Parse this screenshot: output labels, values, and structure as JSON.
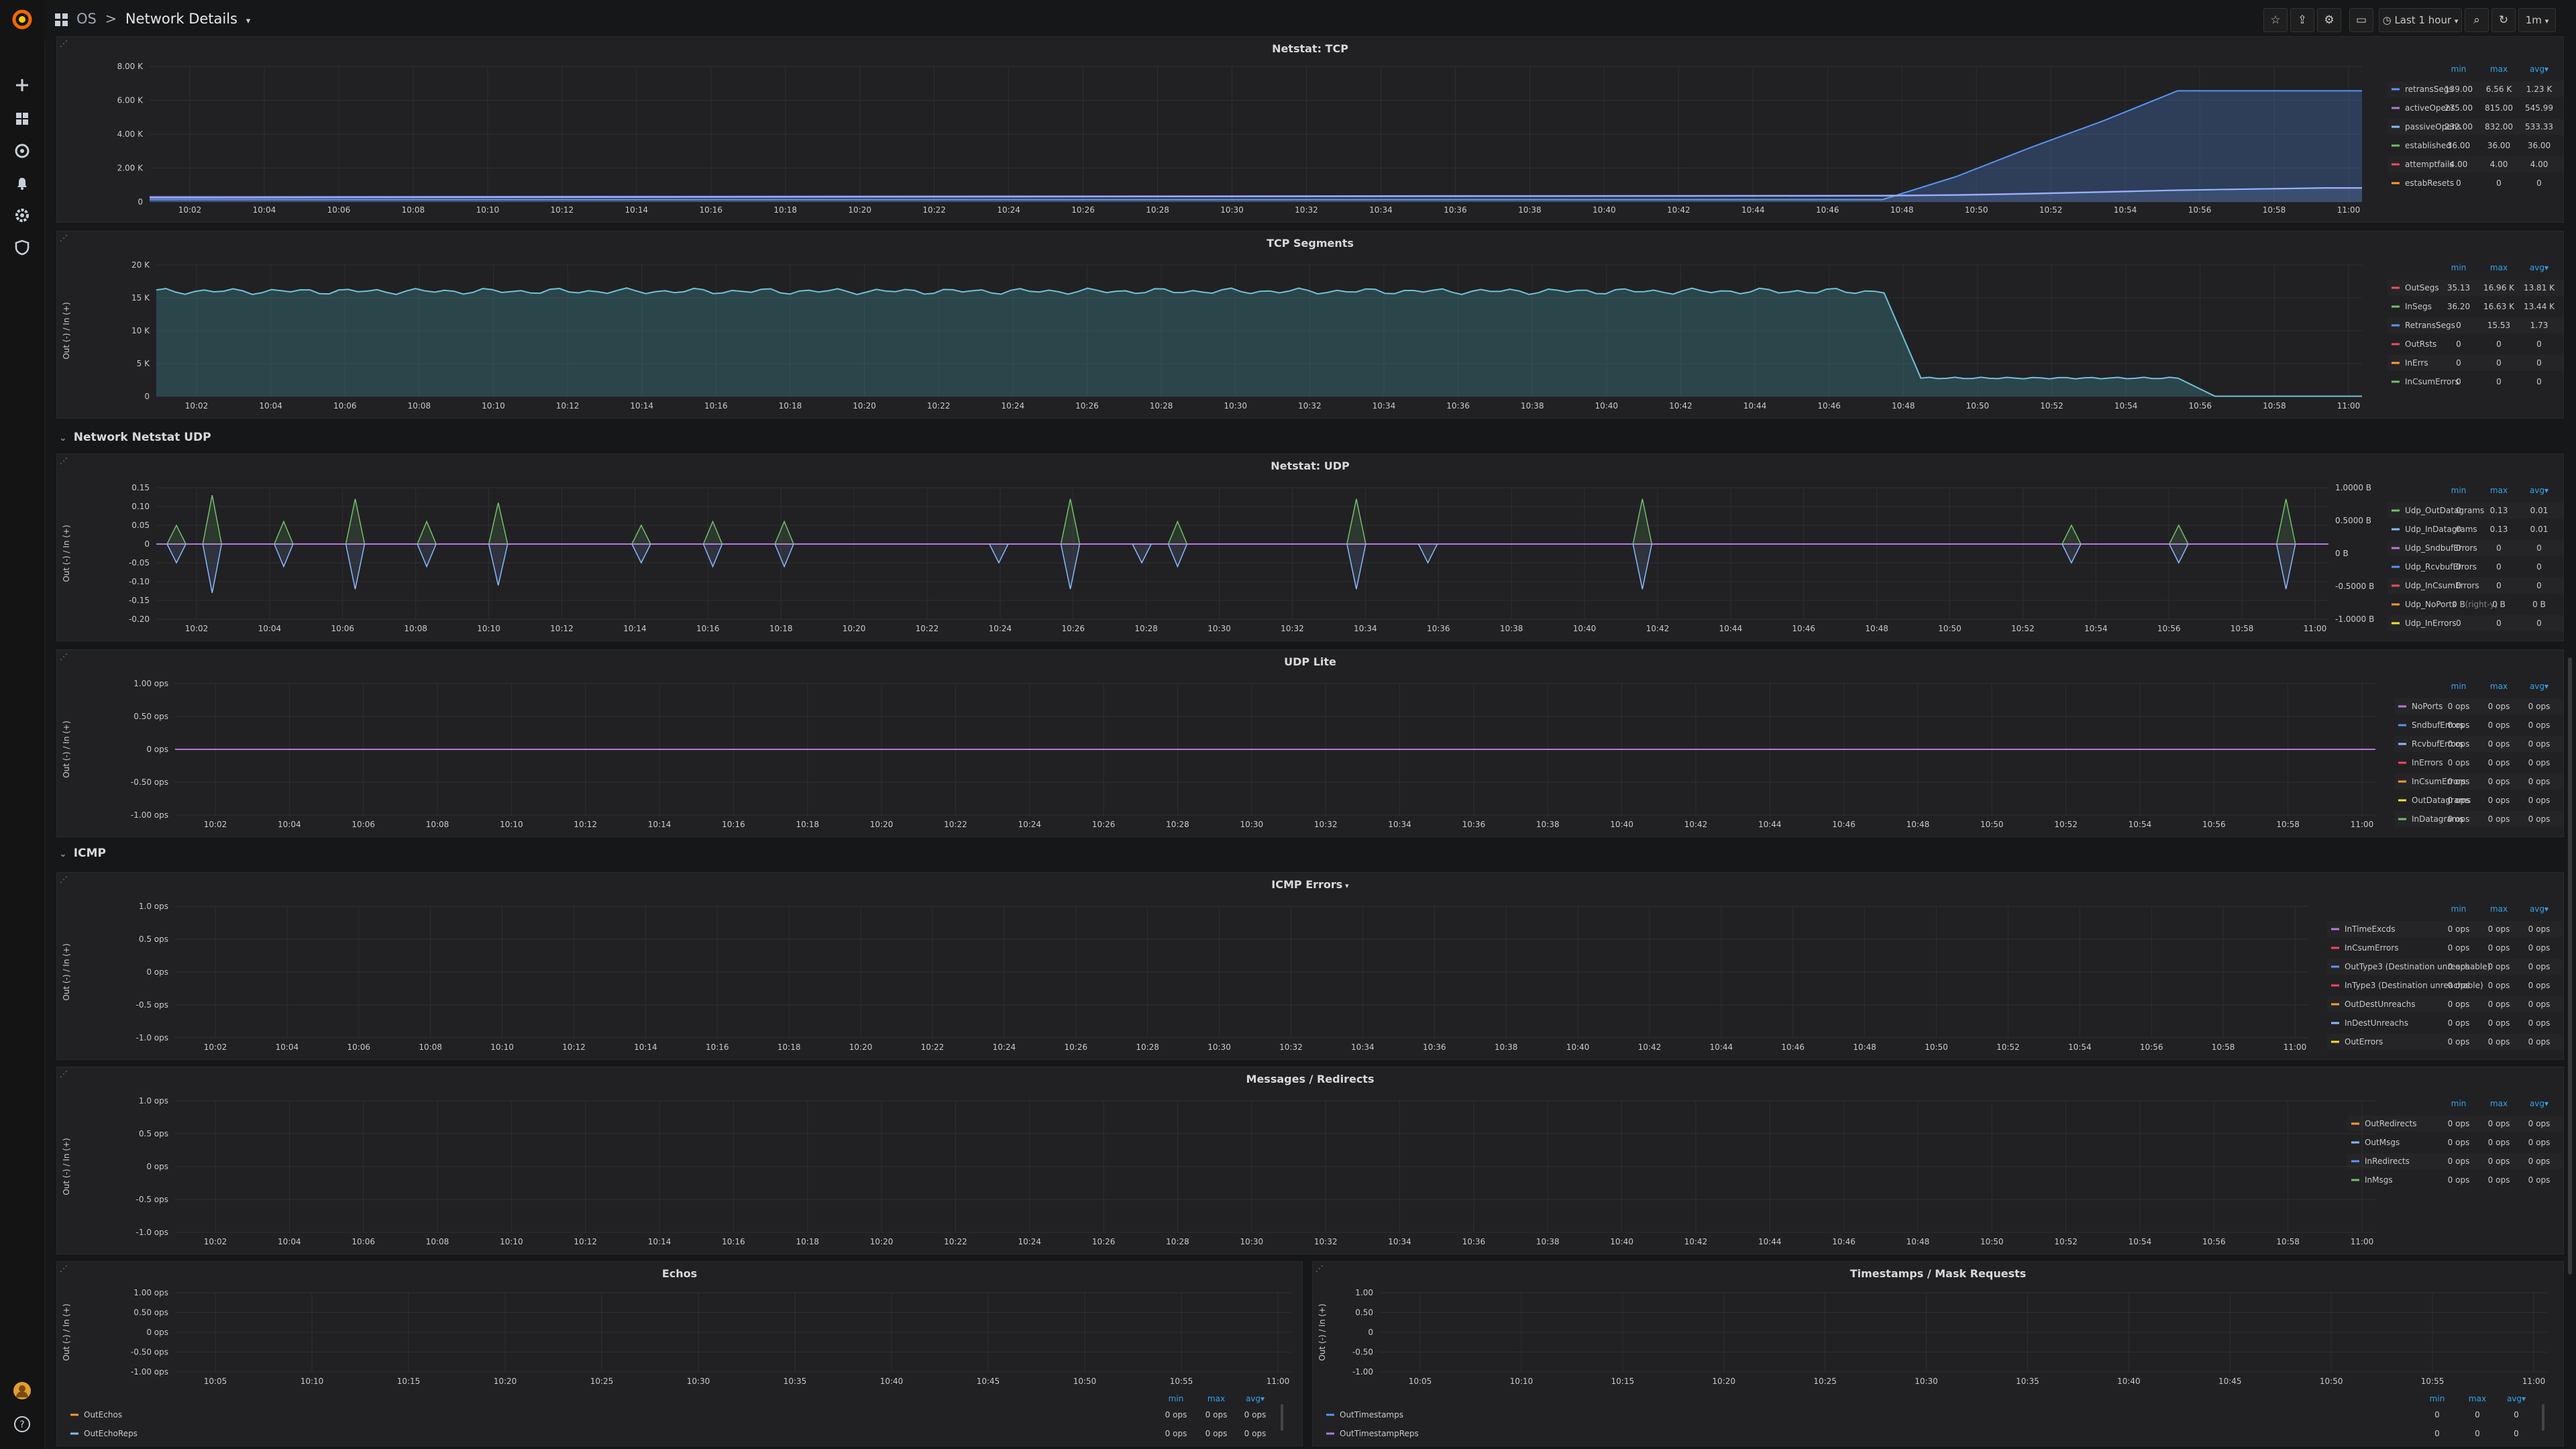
{
  "breadcrumb": {
    "folder": "OS",
    "separator": ">",
    "dashboard": "Network Details"
  },
  "toolbar": {
    "time_range": "Last 1 hour",
    "refresh": "1m"
  },
  "rows": {
    "udp": "Network Netstat UDP",
    "icmp": "ICMP"
  },
  "legend_headers": {
    "min": "min",
    "max": "max",
    "avg": "avg"
  },
  "panels": [
    {
      "id": "netstat-tcp",
      "title": "Netstat: TCP",
      "y_ticks": [
        "8.00 K",
        "6.00 K",
        "4.00 K",
        "2.00 K",
        "0"
      ],
      "x_ticks": [
        "10:02",
        "10:04",
        "10:06",
        "10:08",
        "10:10",
        "10:12",
        "10:14",
        "10:16",
        "10:18",
        "10:20",
        "10:22",
        "10:24",
        "10:26",
        "10:28",
        "10:30",
        "10:32",
        "10:34",
        "10:36",
        "10:38",
        "10:40",
        "10:42",
        "10:44",
        "10:46",
        "10:48",
        "10:50",
        "10:52",
        "10:54",
        "10:56",
        "10:58",
        "11:00"
      ],
      "y_label": "",
      "legend": [
        {
          "name": "retransSegs",
          "color": "#5794f2",
          "min": "139.00",
          "max": "6.56 K",
          "avg": "1.23 K"
        },
        {
          "name": "activeOpens",
          "color": "#b877d9",
          "min": "275.00",
          "max": "815.00",
          "avg": "545.99"
        },
        {
          "name": "passiveOpens",
          "color": "#8ab8ff",
          "min": "232.00",
          "max": "832.00",
          "avg": "533.33"
        },
        {
          "name": "established",
          "color": "#73bf69",
          "min": "36.00",
          "max": "36.00",
          "avg": "36.00"
        },
        {
          "name": "attemptfails",
          "color": "#f2495c",
          "min": "4.00",
          "max": "4.00",
          "avg": "4.00"
        },
        {
          "name": "estabResets",
          "color": "#ff9830",
          "min": "0",
          "max": "0",
          "avg": "0"
        }
      ]
    },
    {
      "id": "tcp-segments",
      "title": "TCP Segments",
      "y_ticks": [
        "20 K",
        "15 K",
        "10 K",
        "5 K",
        "0"
      ],
      "x_ticks": [
        "10:02",
        "10:04",
        "10:06",
        "10:08",
        "10:10",
        "10:12",
        "10:14",
        "10:16",
        "10:18",
        "10:20",
        "10:22",
        "10:24",
        "10:26",
        "10:28",
        "10:30",
        "10:32",
        "10:34",
        "10:36",
        "10:38",
        "10:40",
        "10:42",
        "10:44",
        "10:46",
        "10:48",
        "10:50",
        "10:52",
        "10:54",
        "10:56",
        "10:58",
        "11:00"
      ],
      "y_label": "Out (-) / In (+)",
      "legend": [
        {
          "name": "OutSegs",
          "color": "#f2495c",
          "min": "35.13",
          "max": "16.96 K",
          "avg": "13.81 K"
        },
        {
          "name": "InSegs",
          "color": "#73bf69",
          "min": "36.20",
          "max": "16.63 K",
          "avg": "13.44 K"
        },
        {
          "name": "RetransSegs",
          "color": "#5794f2",
          "min": "0",
          "max": "15.53",
          "avg": "1.73"
        },
        {
          "name": "OutRsts",
          "color": "#f2495c",
          "min": "0",
          "max": "0",
          "avg": "0"
        },
        {
          "name": "InErrs",
          "color": "#ff9830",
          "min": "0",
          "max": "0",
          "avg": "0"
        },
        {
          "name": "InCsumErrors",
          "color": "#73bf69",
          "min": "0",
          "max": "0",
          "avg": "0"
        }
      ]
    },
    {
      "id": "netstat-udp",
      "title": "Netstat: UDP",
      "y_ticks": [
        "0.15",
        "0.10",
        "0.05",
        "0",
        "-0.05",
        "-0.10",
        "-0.15",
        "-0.20"
      ],
      "y_ticks_right": [
        "1.0000 B",
        "0.5000 B",
        "0 B",
        "-0.5000 B",
        "-1.0000 B"
      ],
      "x_ticks": [
        "10:02",
        "10:04",
        "10:06",
        "10:08",
        "10:10",
        "10:12",
        "10:14",
        "10:16",
        "10:18",
        "10:20",
        "10:22",
        "10:24",
        "10:26",
        "10:28",
        "10:30",
        "10:32",
        "10:34",
        "10:36",
        "10:38",
        "10:40",
        "10:42",
        "10:44",
        "10:46",
        "10:48",
        "10:50",
        "10:52",
        "10:54",
        "10:56",
        "10:58",
        "11:00"
      ],
      "y_label": "Out (-) / In (+)",
      "legend": [
        {
          "name": "Udp_OutDatagrams",
          "color": "#73bf69",
          "min": "0",
          "max": "0.13",
          "avg": "0.01"
        },
        {
          "name": "Udp_InDatagrams",
          "color": "#8ab8ff",
          "min": "0",
          "max": "0.13",
          "avg": "0.01"
        },
        {
          "name": "Udp_SndbufErrors",
          "color": "#b877d9",
          "min": "0",
          "max": "0",
          "avg": "0"
        },
        {
          "name": "Udp_RcvbufErrors",
          "color": "#5794f2",
          "min": "0",
          "max": "0",
          "avg": "0"
        },
        {
          "name": "Udp_InCsumErrors",
          "color": "#f2495c",
          "min": "0",
          "max": "0",
          "avg": "0"
        },
        {
          "name": "Udp_NoPorts",
          "suffix": "(right-y)",
          "color": "#ff9830",
          "min": "0 B",
          "max": "0 B",
          "avg": "0 B"
        },
        {
          "name": "Udp_InErrors",
          "color": "#fade2a",
          "min": "0",
          "max": "0",
          "avg": "0"
        }
      ]
    },
    {
      "id": "udp-lite",
      "title": "UDP Lite",
      "y_ticks": [
        "1.00 ops",
        "0.50 ops",
        "0 ops",
        "-0.50 ops",
        "-1.00 ops"
      ],
      "x_ticks": [
        "10:02",
        "10:04",
        "10:06",
        "10:08",
        "10:10",
        "10:12",
        "10:14",
        "10:16",
        "10:18",
        "10:20",
        "10:22",
        "10:24",
        "10:26",
        "10:28",
        "10:30",
        "10:32",
        "10:34",
        "10:36",
        "10:38",
        "10:40",
        "10:42",
        "10:44",
        "10:46",
        "10:48",
        "10:50",
        "10:52",
        "10:54",
        "10:56",
        "10:58",
        "11:00"
      ],
      "y_label": "Out (-) / In (+)",
      "legend": [
        {
          "name": "NoPorts",
          "color": "#b877d9",
          "min": "0 ops",
          "max": "0 ops",
          "avg": "0 ops"
        },
        {
          "name": "SndbufErrors",
          "color": "#5794f2",
          "min": "0 ops",
          "max": "0 ops",
          "avg": "0 ops"
        },
        {
          "name": "RcvbufErrors",
          "color": "#8ab8ff",
          "min": "0 ops",
          "max": "0 ops",
          "avg": "0 ops"
        },
        {
          "name": "InErrors",
          "color": "#f2495c",
          "min": "0 ops",
          "max": "0 ops",
          "avg": "0 ops"
        },
        {
          "name": "InCsumErrors",
          "color": "#ff9830",
          "min": "0 ops",
          "max": "0 ops",
          "avg": "0 ops"
        },
        {
          "name": "OutDatagrams",
          "color": "#fade2a",
          "min": "0 ops",
          "max": "0 ops",
          "avg": "0 ops"
        },
        {
          "name": "InDatagrams",
          "color": "#73bf69",
          "min": "0 ops",
          "max": "0 ops",
          "avg": "0 ops"
        }
      ]
    },
    {
      "id": "icmp-errors",
      "title": "ICMP Errors",
      "y_ticks": [
        "1.0 ops",
        "0.5 ops",
        "0 ops",
        "-0.5 ops",
        "-1.0 ops"
      ],
      "x_ticks": [
        "10:02",
        "10:04",
        "10:06",
        "10:08",
        "10:10",
        "10:12",
        "10:14",
        "10:16",
        "10:18",
        "10:20",
        "10:22",
        "10:24",
        "10:26",
        "10:28",
        "10:30",
        "10:32",
        "10:34",
        "10:36",
        "10:38",
        "10:40",
        "10:42",
        "10:44",
        "10:46",
        "10:48",
        "10:50",
        "10:52",
        "10:54",
        "10:56",
        "10:58",
        "11:00"
      ],
      "y_label": "Out (-) / In (+)",
      "legend": [
        {
          "name": "InTimeExcds",
          "color": "#b877d9",
          "min": "0 ops",
          "max": "0 ops",
          "avg": "0 ops"
        },
        {
          "name": "InCsumErrors",
          "color": "#f2495c",
          "min": "0 ops",
          "max": "0 ops",
          "avg": "0 ops"
        },
        {
          "name": "OutType3 (Destination unreachable)",
          "color": "#5794f2",
          "min": "0 ops",
          "max": "0 ops",
          "avg": "0 ops"
        },
        {
          "name": "InType3 (Destination unreachable)",
          "color": "#f2495c",
          "min": "0 ops",
          "max": "0 ops",
          "avg": "0 ops"
        },
        {
          "name": "OutDestUnreachs",
          "color": "#ff9830",
          "min": "0 ops",
          "max": "0 ops",
          "avg": "0 ops"
        },
        {
          "name": "InDestUnreachs",
          "color": "#8ab8ff",
          "min": "0 ops",
          "max": "0 ops",
          "avg": "0 ops"
        },
        {
          "name": "OutErrors",
          "color": "#fade2a",
          "min": "0 ops",
          "max": "0 ops",
          "avg": "0 ops"
        }
      ]
    },
    {
      "id": "messages-redirects",
      "title": "Messages / Redirects",
      "y_ticks": [
        "1.0 ops",
        "0.5 ops",
        "0 ops",
        "-0.5 ops",
        "-1.0 ops"
      ],
      "x_ticks": [
        "10:02",
        "10:04",
        "10:06",
        "10:08",
        "10:10",
        "10:12",
        "10:14",
        "10:16",
        "10:18",
        "10:20",
        "10:22",
        "10:24",
        "10:26",
        "10:28",
        "10:30",
        "10:32",
        "10:34",
        "10:36",
        "10:38",
        "10:40",
        "10:42",
        "10:44",
        "10:46",
        "10:48",
        "10:50",
        "10:52",
        "10:54",
        "10:56",
        "10:58",
        "11:00"
      ],
      "y_label": "Out (-) / In (+)",
      "legend": [
        {
          "name": "OutRedirects",
          "color": "#ff9830",
          "min": "0 ops",
          "max": "0 ops",
          "avg": "0 ops"
        },
        {
          "name": "OutMsgs",
          "color": "#8ab8ff",
          "min": "0 ops",
          "max": "0 ops",
          "avg": "0 ops"
        },
        {
          "name": "InRedirects",
          "color": "#5794f2",
          "min": "0 ops",
          "max": "0 ops",
          "avg": "0 ops"
        },
        {
          "name": "InMsgs",
          "color": "#73bf69",
          "min": "0 ops",
          "max": "0 ops",
          "avg": "0 ops"
        }
      ]
    },
    {
      "id": "echos",
      "title": "Echos",
      "y_ticks": [
        "1.00 ops",
        "0.50 ops",
        "0 ops",
        "-0.50 ops",
        "-1.00 ops"
      ],
      "x_ticks": [
        "10:05",
        "10:10",
        "10:15",
        "10:20",
        "10:25",
        "10:30",
        "10:35",
        "10:40",
        "10:45",
        "10:50",
        "10:55",
        "11:00"
      ],
      "y_label": "Out (-) / In (+)",
      "legend": [
        {
          "name": "OutEchos",
          "color": "#ff9830",
          "min": "0 ops",
          "max": "0 ops",
          "avg": "0 ops"
        },
        {
          "name": "OutEchoReps",
          "color": "#8ab8ff",
          "min": "0 ops",
          "max": "0 ops",
          "avg": "0 ops"
        }
      ]
    },
    {
      "id": "timestamps",
      "title": "Timestamps / Mask Requests",
      "y_ticks": [
        "1.00",
        "0.50",
        "0",
        "-0.50",
        "-1.00"
      ],
      "x_ticks": [
        "10:05",
        "10:10",
        "10:15",
        "10:20",
        "10:25",
        "10:30",
        "10:35",
        "10:40",
        "10:45",
        "10:50",
        "10:55",
        "11:00"
      ],
      "y_label": "Out (-) / In (+)",
      "legend": [
        {
          "name": "OutTimestamps",
          "color": "#5794f2",
          "min": "0",
          "max": "0",
          "avg": "0"
        },
        {
          "name": "OutTimestampReps",
          "color": "#b877d9",
          "min": "0",
          "max": "0",
          "avg": "0"
        }
      ]
    }
  ],
  "chart_data": [
    {
      "type": "area",
      "title": "Netstat: TCP",
      "ylim": [
        0,
        8000
      ],
      "x": [
        "10:02",
        "10:48",
        "10:50",
        "10:52",
        "10:54",
        "10:56",
        "11:00"
      ],
      "series": [
        {
          "name": "retransSegs",
          "values": [
            139,
            139,
            1500,
            3200,
            4800,
            6560,
            6560
          ]
        },
        {
          "name": "activeOpens",
          "values": [
            300,
            380,
            420,
            500,
            600,
            700,
            815
          ]
        },
        {
          "name": "passiveOpens",
          "values": [
            250,
            360,
            400,
            480,
            580,
            690,
            832
          ]
        }
      ]
    },
    {
      "type": "area",
      "title": "TCP Segments",
      "ylim": [
        0,
        20000
      ],
      "x": [
        "10:01",
        "10:48",
        "10:49",
        "10:56",
        "10:57",
        "11:00"
      ],
      "series": [
        {
          "name": "OutSegs",
          "values": [
            16000,
            16500,
            2800,
            2800,
            35,
            35
          ]
        },
        {
          "name": "InSegs",
          "values": [
            15800,
            16300,
            2600,
            2600,
            36,
            36
          ]
        }
      ]
    },
    {
      "type": "line",
      "title": "Netstat: UDP",
      "ylim": [
        -0.2,
        0.15
      ],
      "spikes_at": [
        "10:01",
        "10:02",
        "10:04",
        "10:06",
        "10:08",
        "10:10",
        "10:14",
        "10:16",
        "10:18",
        "10:24",
        "10:26",
        "10:28",
        "10:29",
        "10:34",
        "10:36",
        "10:42",
        "10:54",
        "10:57",
        "11:00"
      ],
      "spike_heights": [
        0.05,
        0.13,
        0.06,
        0.12,
        0.06,
        0.11,
        0.05,
        0.06,
        0.06,
        0.0,
        0.12,
        0.0,
        0.06,
        0.12,
        0.0,
        0.12,
        0.05,
        0.05,
        0.12
      ]
    },
    {
      "type": "line",
      "title": "UDP Lite",
      "ylim": [
        -1,
        1
      ],
      "values": "all 0"
    },
    {
      "type": "line",
      "title": "ICMP Errors",
      "ylim": [
        -1,
        1
      ],
      "values": "all 0"
    },
    {
      "type": "line",
      "title": "Messages / Redirects",
      "ylim": [
        -1,
        1
      ],
      "values": "all 0"
    },
    {
      "type": "line",
      "title": "Echos",
      "ylim": [
        -1,
        1
      ],
      "values": "all 0"
    },
    {
      "type": "line",
      "title": "Timestamps / Mask Requests",
      "ylim": [
        -1,
        1
      ],
      "values": "all 0"
    }
  ]
}
